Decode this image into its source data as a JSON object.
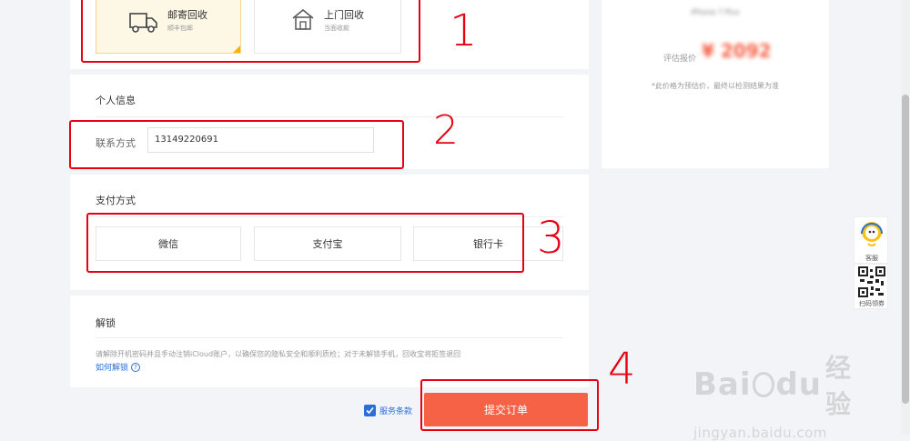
{
  "recycle": {
    "mail": {
      "title": "邮寄回收",
      "subtitle": "顺丰包邮",
      "icon": "truck-icon"
    },
    "door": {
      "title": "上门回收",
      "subtitle": "当面收款",
      "icon": "house-icon"
    }
  },
  "personal": {
    "title": "个人信息",
    "contact_label": "联系方式",
    "contact_value": "13149220691"
  },
  "payment": {
    "title": "支付方式",
    "options": [
      "微信",
      "支付宝",
      "银行卡"
    ]
  },
  "unlock": {
    "title": "解锁",
    "notice": "请解除开机密码并且手动注销iCloud账户，以确保您的隐私安全和顺利质检；对于未解锁手机，回收宝将拒签退回",
    "how_link": "如何解锁"
  },
  "order": {
    "terms": "服务条款",
    "submit": "提交订单"
  },
  "summary": {
    "model": "iPhone 7 Plus",
    "price_label": "评估报价",
    "price": "¥ 2092",
    "note": "*此价格为预估价，最终以检测结果为准"
  },
  "float": {
    "service_label": "客服",
    "qr_label": "扫码领券"
  },
  "annotations": [
    "1",
    "2",
    "3",
    "4"
  ],
  "watermark": {
    "brand": "Bai",
    "brand2": "du",
    "cn": "经验",
    "url": "jingyan.baidu.com"
  },
  "colors": {
    "accent": "#f56246",
    "annotation": "#e60012",
    "price": "#f56246"
  }
}
